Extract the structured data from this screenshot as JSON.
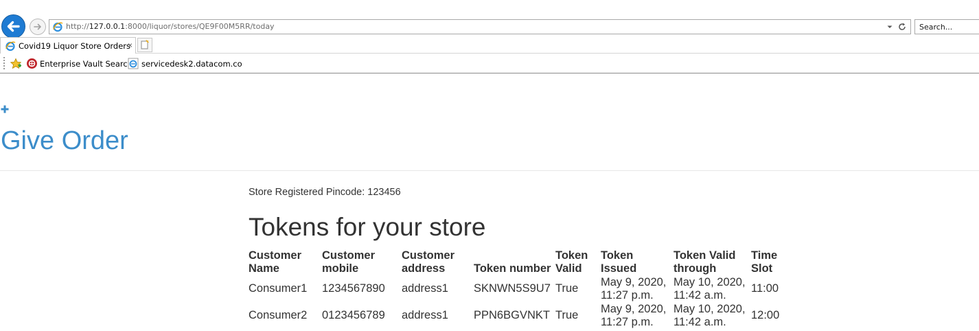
{
  "browser": {
    "address": {
      "url_scheme": "http://",
      "url_host": "127.0.0.1",
      "url_rest": ":8000/liquor/stores/QE9F00M5RR/today"
    },
    "search_placeholder": "Search...",
    "tab": {
      "title": "Covid19 Liquor Store Orders",
      "close_glyph": "×"
    },
    "favorites": [
      {
        "label": "Enterprise Vault Search"
      },
      {
        "label": "servicedesk2.datacom.co"
      }
    ]
  },
  "navbar": {
    "plus_glyph": "+",
    "brand": "Give Order",
    "brand_color": "#3c8dca"
  },
  "store": {
    "pincode_line": "Store Registered Pincode: 123456"
  },
  "tokens": {
    "heading": "Tokens for your store",
    "columns": [
      "Customer Name",
      "Customer mobile",
      "Customer address",
      "Token number",
      "Token Valid",
      "Token Issued",
      "Token Valid through",
      "Time Slot"
    ],
    "rows": [
      [
        "Consumer1",
        "1234567890",
        "address1",
        "SKNWN5S9U7",
        "True",
        "May 9, 2020, 11:27 p.m.",
        "May 10, 2020, 11:42 a.m.",
        "11:00"
      ],
      [
        "Consumer2",
        "0123456789",
        "address1",
        "PPN6BGVNKT",
        "True",
        "May 9, 2020, 11:27 p.m.",
        "May 10, 2020, 11:42 a.m.",
        "12:00"
      ]
    ]
  }
}
